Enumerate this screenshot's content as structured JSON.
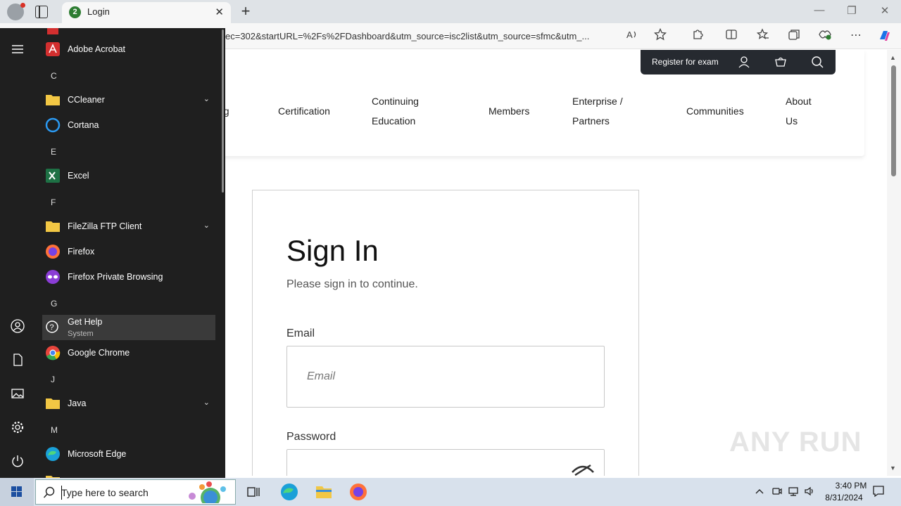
{
  "browser": {
    "tab_title": "Login",
    "tab_favicon_letter": "2",
    "address": "ec=302&startURL=%2Fs%2FDashboard&utm_source=isc2list&utm_source=sfmc&utm_...",
    "new_tab": "+",
    "close_tab": "✕"
  },
  "site": {
    "register_label": "Register for exam",
    "nav": [
      {
        "line1": "ng",
        "line2": ""
      },
      {
        "line1": "Certification",
        "line2": ""
      },
      {
        "line1": "Continuing",
        "line2": "Education"
      },
      {
        "line1": "Members",
        "line2": ""
      },
      {
        "line1": "Enterprise /",
        "line2": "Partners"
      },
      {
        "line1": "Communities",
        "line2": ""
      },
      {
        "line1": "About",
        "line2": "Us"
      }
    ]
  },
  "signin": {
    "title": "Sign In",
    "subtitle": "Please sign in to continue.",
    "email_label": "Email",
    "email_placeholder": "Email",
    "password_label": "Password"
  },
  "watermark": "ANY RUN",
  "start_menu": {
    "sections": [
      {
        "type": "app",
        "label": "Adobe Acrobat",
        "icon": "acrobat-icon"
      },
      {
        "type": "letter",
        "label": "C"
      },
      {
        "type": "folder",
        "label": "CCleaner",
        "icon": "folder-icon"
      },
      {
        "type": "app",
        "label": "Cortana",
        "icon": "cortana-icon"
      },
      {
        "type": "letter",
        "label": "E"
      },
      {
        "type": "app",
        "label": "Excel",
        "icon": "excel-icon"
      },
      {
        "type": "letter",
        "label": "F"
      },
      {
        "type": "folder",
        "label": "FileZilla FTP Client",
        "icon": "folder-icon"
      },
      {
        "type": "app",
        "label": "Firefox",
        "icon": "firefox-icon"
      },
      {
        "type": "app",
        "label": "Firefox Private Browsing",
        "icon": "firefox-private-icon"
      },
      {
        "type": "letter",
        "label": "G"
      },
      {
        "type": "app",
        "label": "Get Help",
        "sub": "System",
        "icon": "get-help-icon"
      },
      {
        "type": "app",
        "label": "Google Chrome",
        "icon": "chrome-icon"
      },
      {
        "type": "letter",
        "label": "J"
      },
      {
        "type": "folder",
        "label": "Java",
        "icon": "folder-icon"
      },
      {
        "type": "letter",
        "label": "M"
      },
      {
        "type": "app",
        "label": "Microsoft Edge",
        "icon": "edge-icon"
      }
    ]
  },
  "taskbar": {
    "search_placeholder": "Type here to search",
    "time": "3:40 PM",
    "date": "8/31/2024"
  },
  "colors": {
    "start_bg": "#1f1f1f",
    "topbar_bg": "#262a30",
    "taskbar_bg": "#d8e1ec"
  }
}
